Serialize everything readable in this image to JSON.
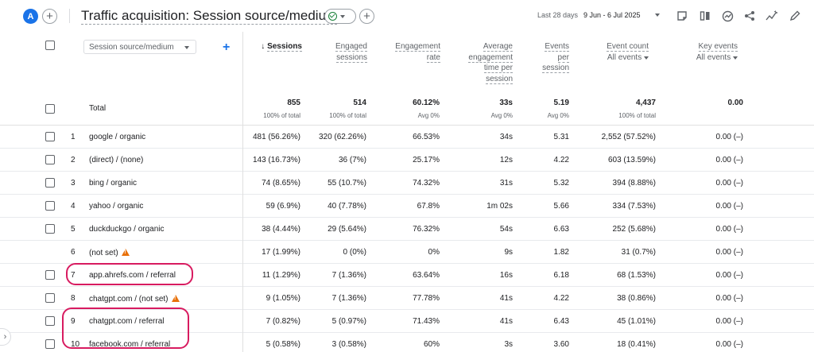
{
  "header": {
    "avatar_letter": "A",
    "title": "Traffic acquisition: Session source/medium",
    "date_label": "Last 28 days",
    "date_range": "9 Jun - 6 Jul 2025",
    "icons": [
      "plus-icon",
      "check-circle-icon",
      "chevron-down-icon",
      "plus-icon",
      "notes-icon",
      "compare-columns-icon",
      "insights-icon",
      "share-icon",
      "trend-icon",
      "edit-icon"
    ]
  },
  "table": {
    "dimension": "Session source/medium",
    "columns": {
      "sessions": "Sessions",
      "engaged": [
        "Engaged",
        "sessions"
      ],
      "engagement_rate": [
        "Engagement",
        "rate"
      ],
      "avg_time": [
        "Average",
        "engagement",
        "time per",
        "session"
      ],
      "events_per": [
        "Events",
        "per",
        "session"
      ],
      "event_count": "Event count",
      "event_count_sub": "All events",
      "key_events": "Key events",
      "key_events_sub": "All events"
    },
    "totals": {
      "label": "Total",
      "sessions": "855",
      "sessions_sub": "100% of total",
      "engaged": "514",
      "engaged_sub": "100% of total",
      "rate": "60.12%",
      "rate_sub": "Avg 0%",
      "time": "33s",
      "time_sub": "Avg 0%",
      "events_per": "5.19",
      "events_per_sub": "Avg 0%",
      "event_count": "4,437",
      "event_count_sub": "100% of total",
      "key_events": "0.00"
    },
    "rows": [
      {
        "idx": "1",
        "source": "google / organic",
        "sessions": "481 (56.26%)",
        "engaged": "320 (62.26%)",
        "rate": "66.53%",
        "time": "34s",
        "events_per": "5.31",
        "event_count": "2,552 (57.52%)",
        "key_events": "0.00 (–)"
      },
      {
        "idx": "2",
        "source": "(direct) / (none)",
        "sessions": "143 (16.73%)",
        "engaged": "36 (7%)",
        "rate": "25.17%",
        "time": "12s",
        "events_per": "4.22",
        "event_count": "603 (13.59%)",
        "key_events": "0.00 (–)"
      },
      {
        "idx": "3",
        "source": "bing / organic",
        "sessions": "74 (8.65%)",
        "engaged": "55 (10.7%)",
        "rate": "74.32%",
        "time": "31s",
        "events_per": "5.32",
        "event_count": "394 (8.88%)",
        "key_events": "0.00 (–)"
      },
      {
        "idx": "4",
        "source": "yahoo / organic",
        "sessions": "59 (6.9%)",
        "engaged": "40 (7.78%)",
        "rate": "67.8%",
        "time": "1m 02s",
        "events_per": "5.66",
        "event_count": "334 (7.53%)",
        "key_events": "0.00 (–)"
      },
      {
        "idx": "5",
        "source": "duckduckgo / organic",
        "sessions": "38 (4.44%)",
        "engaged": "29 (5.64%)",
        "rate": "76.32%",
        "time": "54s",
        "events_per": "6.63",
        "event_count": "252 (5.68%)",
        "key_events": "0.00 (–)"
      },
      {
        "idx": "6",
        "source": "(not set)",
        "sessions": "17 (1.99%)",
        "engaged": "0 (0%)",
        "rate": "0%",
        "time": "9s",
        "events_per": "1.82",
        "event_count": "31 (0.7%)",
        "key_events": "0.00 (–)"
      },
      {
        "idx": "7",
        "source": "app.ahrefs.com / referral",
        "sessions": "11 (1.29%)",
        "engaged": "7 (1.36%)",
        "rate": "63.64%",
        "time": "16s",
        "events_per": "6.18",
        "event_count": "68 (1.53%)",
        "key_events": "0.00 (–)"
      },
      {
        "idx": "8",
        "source": "chatgpt.com / (not set)",
        "sessions": "9 (1.05%)",
        "engaged": "7 (1.36%)",
        "rate": "77.78%",
        "time": "41s",
        "events_per": "4.22",
        "event_count": "38 (0.86%)",
        "key_events": "0.00 (–)"
      },
      {
        "idx": "9",
        "source": "chatgpt.com / referral",
        "sessions": "7 (0.82%)",
        "engaged": "5 (0.97%)",
        "rate": "71.43%",
        "time": "41s",
        "events_per": "6.43",
        "event_count": "45 (1.01%)",
        "key_events": "0.00 (–)"
      },
      {
        "idx": "10",
        "source": "facebook.com / referral",
        "sessions": "5 (0.58%)",
        "engaged": "3 (0.58%)",
        "rate": "60%",
        "time": "3s",
        "events_per": "3.60",
        "event_count": "18 (0.41%)",
        "key_events": "0.00 (–)"
      }
    ],
    "highlight_color": "#d81b60",
    "warning_color": "#e8710a"
  },
  "side_toggle": "›"
}
